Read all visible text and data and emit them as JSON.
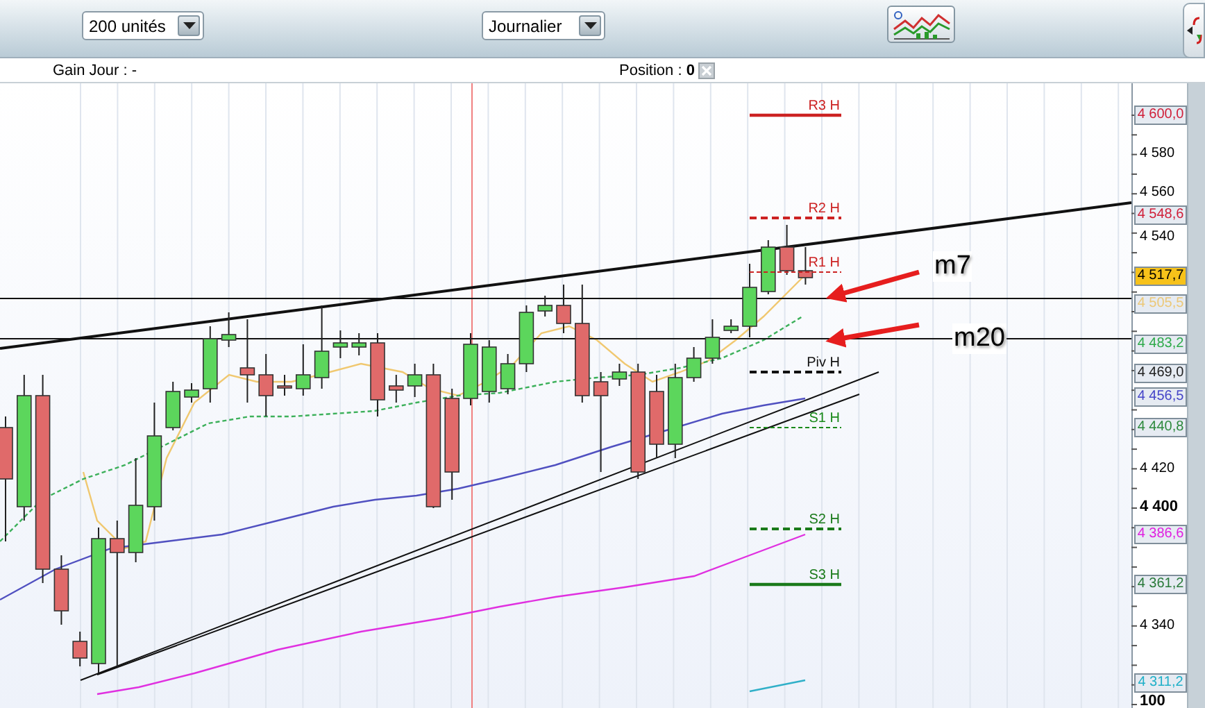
{
  "toolbar": {
    "units_select": {
      "value": "200 unités"
    },
    "period_select": {
      "value": "Journalier"
    }
  },
  "info_bar": {
    "gain": "Gain Jour : -",
    "position": "Position : **0**"
  },
  "chart": {
    "pivot_levels": [
      {
        "label": "R3 H",
        "color": "#cc2222",
        "kind": "solid"
      },
      {
        "label": "R2 H",
        "color": "#cc2222",
        "kind": "dashed"
      },
      {
        "label": "R1 H",
        "color": "#cc2222",
        "kind": "dotted"
      },
      {
        "label": "Piv H",
        "color": "#111111",
        "kind": "dashed"
      },
      {
        "label": "S1 H",
        "color": "#1a8a1a",
        "kind": "dotted"
      },
      {
        "label": "S2 H",
        "color": "#1a7a1a",
        "kind": "dashed"
      },
      {
        "label": "S3 H",
        "color": "#1a7a1a",
        "kind": "solid"
      }
    ],
    "annotations": [
      {
        "text": "m7"
      },
      {
        "text": "m20"
      }
    ],
    "axis_ticks": [
      {
        "label": "4 580",
        "bold": false
      },
      {
        "label": "4 560",
        "bold": false
      },
      {
        "label": "4 540",
        "bold": false
      },
      {
        "label": "4 420",
        "bold": false
      },
      {
        "label": "4 400",
        "bold": true
      },
      {
        "label": "4 340",
        "bold": false
      },
      {
        "label": "100",
        "bold": true
      }
    ],
    "price_tags": [
      {
        "label": "4 600,0",
        "color": "#d0203a",
        "highlighted": false
      },
      {
        "label": "4 548,6",
        "color": "#d0203a",
        "highlighted": false
      },
      {
        "label": "4 517,7",
        "highlighted": true
      },
      {
        "label": "4 505,5",
        "color": "#ecc878",
        "highlighted": false
      },
      {
        "label": "4 483,2",
        "color": "#2eaa4a",
        "highlighted": false
      },
      {
        "label": "4 469,0",
        "color": "#222222",
        "highlighted": false
      },
      {
        "label": "4 456,5",
        "color": "#4646c8",
        "highlighted": false
      },
      {
        "label": "4 440,8",
        "color": "#2e8a3e",
        "highlighted": false
      },
      {
        "label": "4 386,6",
        "color": "#e020e0",
        "highlighted": false
      },
      {
        "label": "4 361,2",
        "color": "#2a7a3a",
        "highlighted": false
      },
      {
        "label": "4 311,2",
        "color": "#20b0c8",
        "highlighted": false
      }
    ]
  }
}
